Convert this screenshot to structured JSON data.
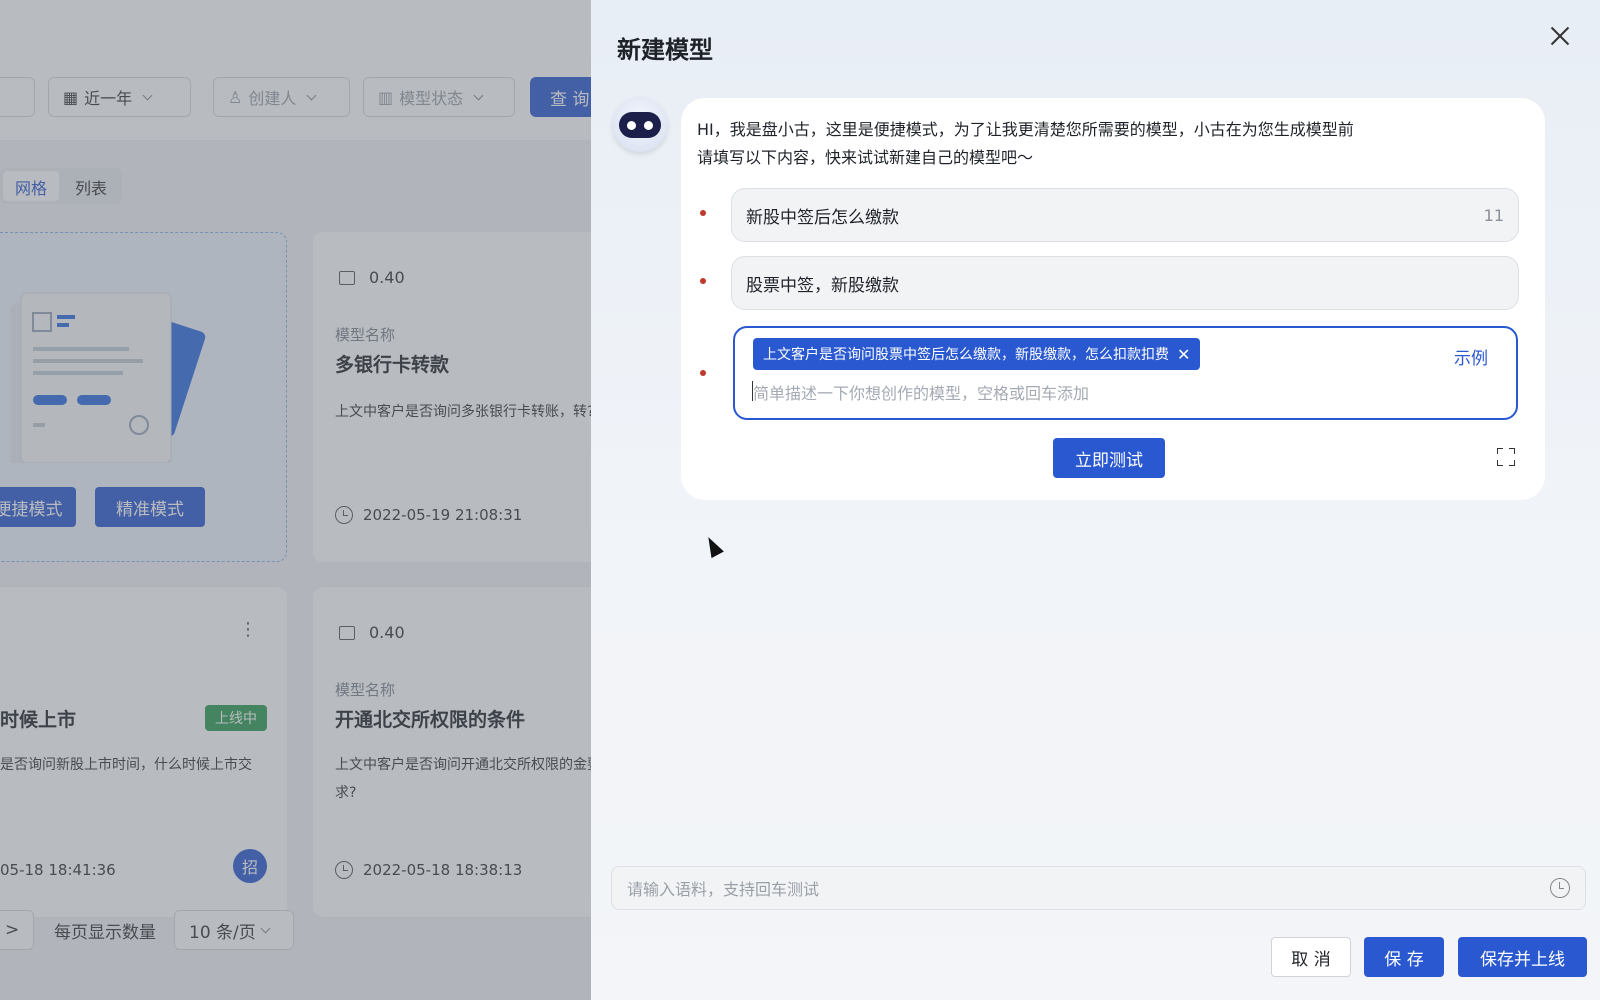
{
  "background": {
    "filters": {
      "date_range": "近一年",
      "creator": "创建人",
      "model_status": "模型状态",
      "query_button": "查 询"
    },
    "view_toggle": {
      "grid": "网格",
      "list": "列表"
    },
    "new_card": {
      "quick_mode": "便捷模式",
      "precise_mode": "精准模式"
    },
    "cards": [
      {
        "score": "0.40",
        "name_label": "模型名称",
        "name": "多银行卡转款",
        "desc": "上文中客户是否询问多张银行卡转账，转?",
        "time": "2022-05-19 21:08:31"
      },
      {
        "name": "时候上市",
        "status_badge": "上线中",
        "desc": "是否询问新股上市时间，什么时候上市交",
        "time": "05-18 18:41:36",
        "badge": "招"
      },
      {
        "score": "0.40",
        "name_label": "模型名称",
        "name": "开通北交所权限的条件",
        "desc": "上文中客户是否询问开通北交所权限的金要求?",
        "time": "2022-05-18 18:38:13"
      }
    ],
    "pagination": {
      "next": ">",
      "page_size_label": "每页显示数量",
      "page_size_value": "10 条/页"
    }
  },
  "drawer": {
    "title": "新建模型",
    "greeting_line1": "HI，我是盘小古，这里是便捷模式，为了让我更清楚您所需要的模型，小古在为您生成模型前",
    "greeting_line2": "请填写以下内容，快来试试新建自己的模型吧～",
    "field1": {
      "value": "新股中签后怎么缴款",
      "count": "11"
    },
    "field2": {
      "value": "股票中签，新股缴款"
    },
    "field3": {
      "tag": "上文客户是否询问股票中签后怎么缴款，新股缴款，怎么扣款扣费",
      "example_link": "示例",
      "placeholder": "简单描述一下你想创作的模型，空格或回车添加"
    },
    "test_button": "立即测试",
    "corpus_placeholder": "请输入语料，支持回车测试",
    "footer": {
      "cancel": "取 消",
      "save": "保 存",
      "save_online": "保存并上线"
    }
  },
  "colors": {
    "primary": "#2a58d0",
    "online": "#2e9c52",
    "required": "#c0392b"
  }
}
